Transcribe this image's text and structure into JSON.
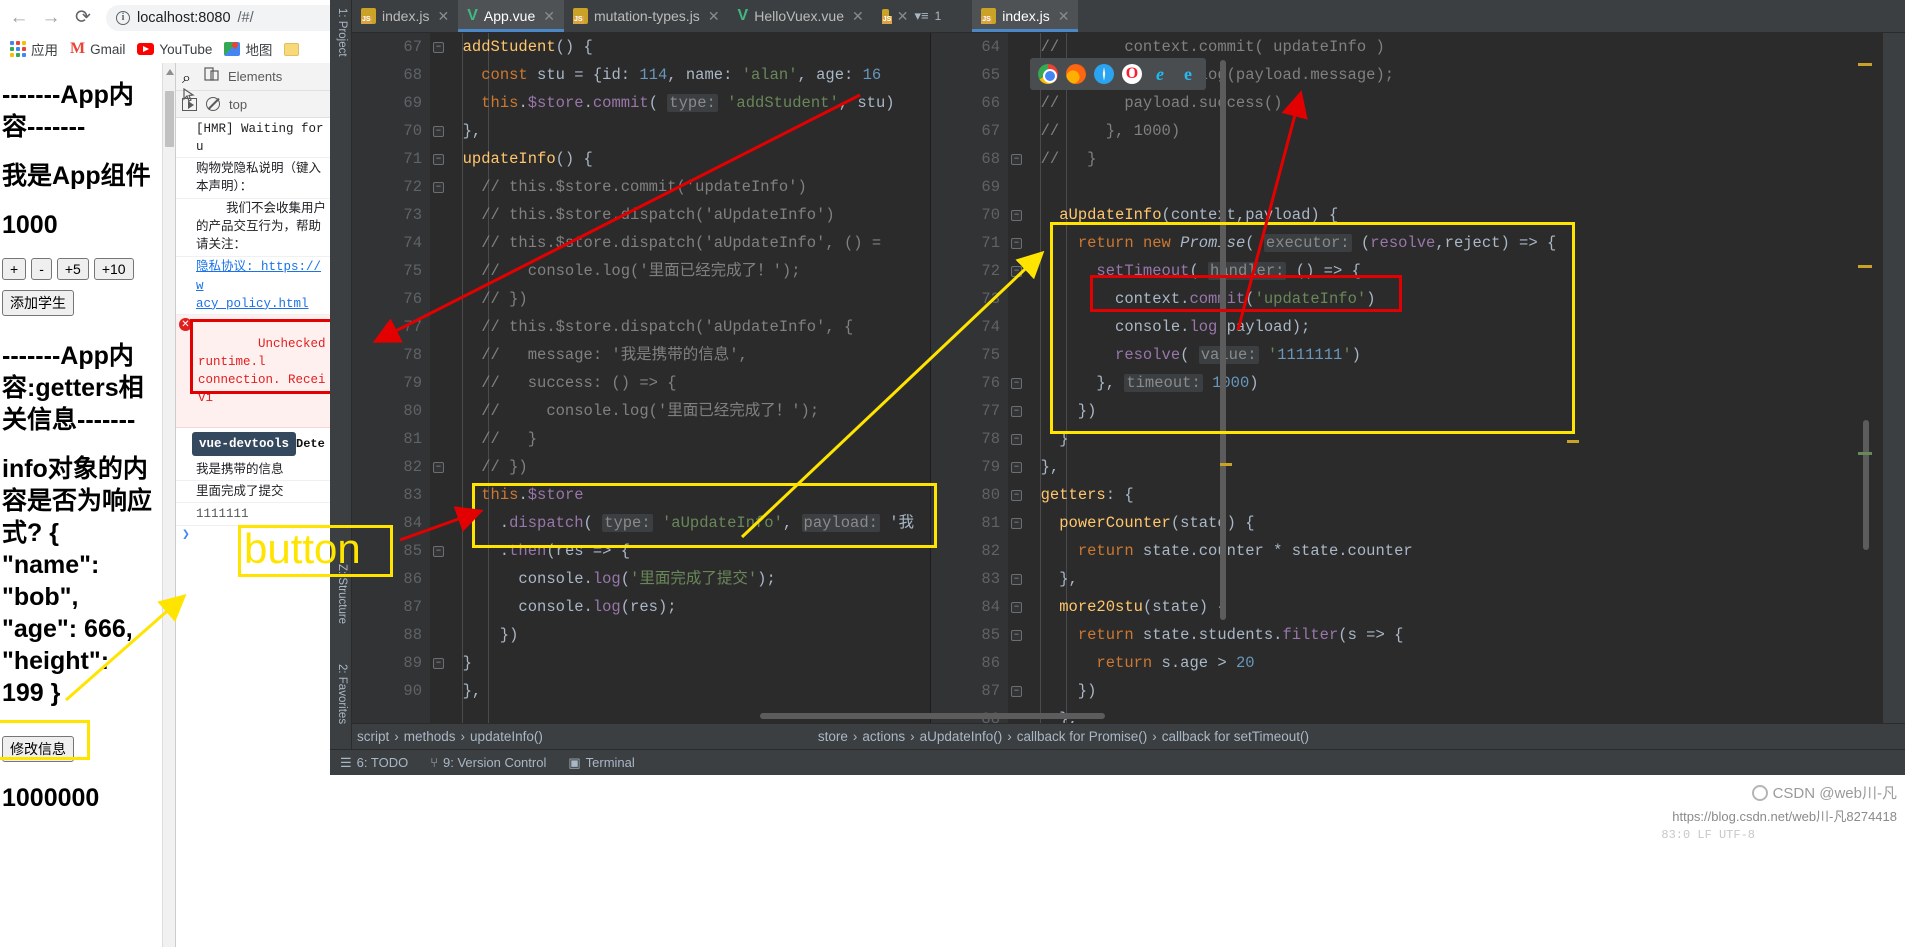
{
  "browser": {
    "nav": {
      "back": "←",
      "forward": "→",
      "reload": "⟳",
      "star": "☆"
    },
    "omnibox": {
      "host": "localhost:8080",
      "rest": "/#/",
      "info": "i"
    },
    "bookmarks": [
      {
        "label": "应用",
        "icon": "apps-grid-icon"
      },
      {
        "label": "Gmail",
        "icon": "gmail-icon"
      },
      {
        "label": "YouTube",
        "icon": "youtube-icon"
      },
      {
        "label": "地图",
        "icon": "maps-icon"
      },
      {
        "label": "",
        "icon": "folder-icon"
      }
    ]
  },
  "app_page": {
    "header1": "-------App内容-------",
    "line1": "我是App组件",
    "counter": "1000",
    "buttons": {
      "plus": "+",
      "minus": "-",
      "plus5": "+5",
      "plus10": "+10",
      "add_student": "添加学生"
    },
    "header2": "-------App内容:getters相关信息-------",
    "info_text": "info对象的内容是否为响应式? { \"name\": \"bob\", \"age\": 666, \"height\": 199 }",
    "modify_button": "修改信息",
    "power_counter": "1000000"
  },
  "devtools": {
    "tabs": {
      "elements": "Elements"
    },
    "filter": {
      "context": "top"
    },
    "console_rows": [
      {
        "text": "[HMR] Waiting for u",
        "type": "log"
      },
      {
        "text": "购物党隐私说明（键入\n本声明）：",
        "type": "log"
      },
      {
        "text": "    我们不会收集用户\n的产品交互行为，帮助\n请关注：",
        "type": "log"
      },
      {
        "text": "隐私协议: https://w\nacy_policy.html",
        "type": "link"
      },
      {
        "text": "Unchecked runtime.l\nconnection. Receivi",
        "type": "error"
      }
    ],
    "vue_badge": "vue-devtools",
    "vue_badge_suffix": "Dete",
    "highlighted_output": [
      "我是携带的信息",
      "里面完成了提交",
      "1111111"
    ],
    "prompt": "❯"
  },
  "ide": {
    "tabs": [
      {
        "label": "index.js",
        "icon": "js-file-icon",
        "active": false
      },
      {
        "label": "App.vue",
        "icon": "vue-file-icon",
        "active": true
      },
      {
        "label": "mutation-types.js",
        "icon": "js-file-icon",
        "active": false
      },
      {
        "label": "HelloVuex.vue",
        "icon": "vue-file-icon",
        "active": false
      }
    ],
    "tab_overflow": "1",
    "right_tab": {
      "label": "index.js",
      "icon": "js-file-icon"
    },
    "tool_windows": {
      "project": "1: Project",
      "structure": "Z: Structure",
      "favorites": "2: Favorites"
    },
    "browser_picker": [
      "chrome",
      "firefox",
      "safari",
      "opera",
      "ie",
      "edge"
    ],
    "left_editor": {
      "first_line_number": 67,
      "lines": [
        "  addStudent() {",
        "    const stu = {id: 114, name: 'alan', age: 16",
        "    this.$store.commit( type: 'addStudent', stu)",
        "  },",
        "  updateInfo() {",
        "    // this.$store.commit('updateInfo')",
        "    // this.$store.dispatch('aUpdateInfo')",
        "    // this.$store.dispatch('aUpdateInfo', () =",
        "    //   console.log('里面已经完成了！');",
        "    // })",
        "    // this.$store.dispatch('aUpdateInfo', {",
        "    //   message: '我是携带的信息',",
        "    //   success: () => {",
        "    //     console.log('里面已经完成了！');",
        "    //   }",
        "    // })",
        "    this.$store",
        "      .dispatch( type: 'aUpdateInfo', payload: '我",
        "      .then(res => {",
        "        console.log('里面完成了提交');",
        "        console.log(res);",
        "      })",
        "  }",
        "  },"
      ]
    },
    "right_editor": {
      "first_line_number": 64,
      "lines": [
        "  //       context.commit( updateInfo )",
        "  //       console.log(payload.message);",
        "  //       payload.success()",
        "  //     }, 1000)",
        "  //   }",
        "",
        "    aUpdateInfo(context,payload) {",
        "      return new Promise( executor: (resolve,reject) => {",
        "        setTimeout( handler: () => {",
        "          context.commit('updateInfo')",
        "          console.log(payload);",
        "          resolve( value: '1111111')",
        "        }, timeout: 1000)",
        "      })",
        "    }",
        "  },",
        "  getters: {",
        "    powerCounter(state) {",
        "      return state.counter * state.counter",
        "    },",
        "    more20stu(state) {",
        "      return state.students.filter(s => {",
        "        return s.age > 20",
        "      })",
        "    },"
      ]
    },
    "breadcrumbs_left": [
      "script",
      "methods",
      "updateInfo()"
    ],
    "breadcrumbs_right": [
      "store",
      "actions",
      "aUpdateInfo()",
      "callback for Promise()",
      "callback for setTimeout()"
    ],
    "statusbar": [
      {
        "icon": "todo-icon",
        "label": "6: TODO"
      },
      {
        "icon": "branch-icon",
        "label": "9: Version Control"
      },
      {
        "icon": "terminal-icon",
        "label": "Terminal"
      }
    ]
  },
  "annotations": {
    "button_label": "button",
    "highlight_colors": {
      "yellow": "#FFE400",
      "red": "#E30000"
    }
  },
  "watermark": {
    "text": "CSDN @web川-凡",
    "url": "https://blog.csdn.net/web川-凡8274418",
    "extra": "83:0  LF  UTF-8"
  }
}
